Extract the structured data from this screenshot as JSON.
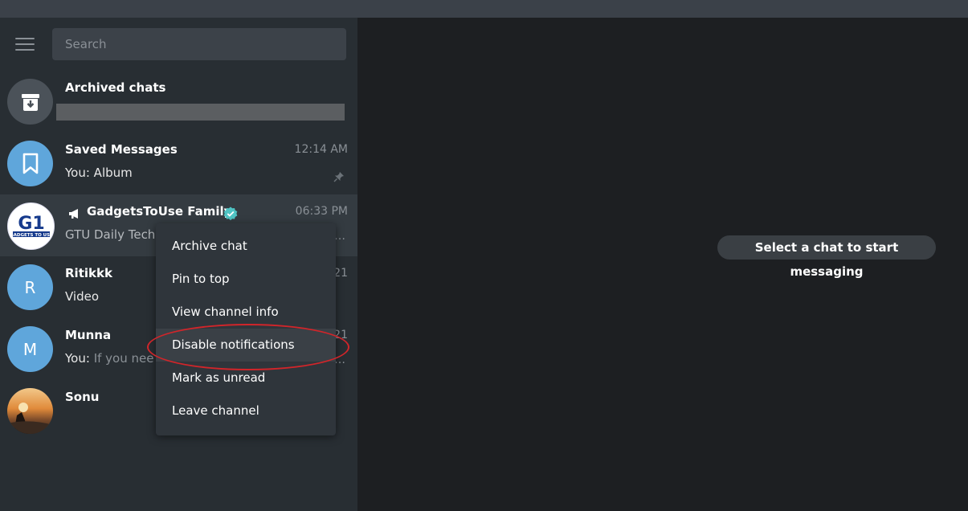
{
  "search": {
    "placeholder": "Search"
  },
  "chats": [
    {
      "name": "Archived chats",
      "preview": "",
      "time": "",
      "avatar_icon": "archive-icon",
      "avatar_color": "#4b5259"
    },
    {
      "name": "Saved Messages",
      "preview": "You: Album",
      "time": "12:14 AM",
      "avatar_icon": "bookmark-icon",
      "avatar_color": "#5fa6db",
      "pinned": true
    },
    {
      "name": "GadgetsToUse Family",
      "preview": "GTU Daily Tech",
      "time": "06:33 PM",
      "avatar_icon": "gtu-logo",
      "channel": true,
      "verified": true
    },
    {
      "name": "Ritikkk",
      "preview": "Video",
      "time": "21",
      "avatar_letter": "R",
      "avatar_color": "#5fa6db"
    },
    {
      "name": "Munna",
      "preview_prefix": "You:",
      "preview": "If you nee",
      "time": "21",
      "avatar_letter": "M",
      "avatar_color": "#5fa6db"
    },
    {
      "name": "Sonu",
      "preview": "",
      "time": "",
      "avatar_icon": "photo-avatar"
    }
  ],
  "context_menu": {
    "items": [
      "Archive chat",
      "Pin to top",
      "View channel info",
      "Disable notifications",
      "Mark as unread",
      "Leave channel"
    ]
  },
  "main": {
    "empty_hint": "Select a chat to start messaging"
  },
  "colors": {
    "sidebar": "#282e33",
    "main": "#1d1f22",
    "accent": "#5fa6db",
    "highlight": "#d1252a"
  }
}
